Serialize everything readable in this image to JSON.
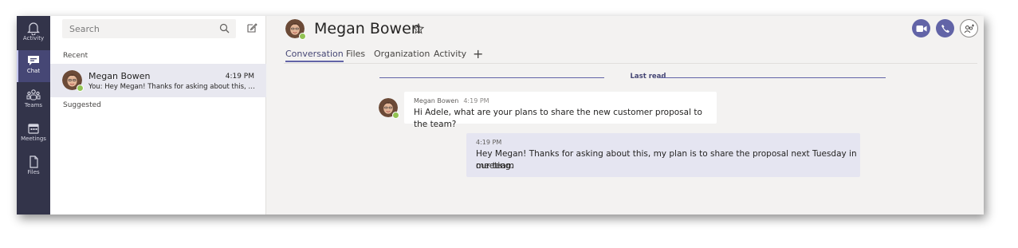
{
  "rail": {
    "items": [
      {
        "label": "Activity"
      },
      {
        "label": "Chat"
      },
      {
        "label": "Teams"
      },
      {
        "label": "Meetings"
      },
      {
        "label": "Files"
      }
    ]
  },
  "list": {
    "search_placeholder": "Search",
    "recent_label": "Recent",
    "suggested_label": "Suggested",
    "chats": [
      {
        "name": "Megan Bowen",
        "time": "4:19 PM",
        "preview": "You: Hey Megan! Thanks for asking about this, my plan is to share the proposal next Tuesday in our team meeting."
      }
    ]
  },
  "header": {
    "name": "Megan Bowen",
    "tabs": [
      {
        "label": "Conversation"
      },
      {
        "label": "Files"
      },
      {
        "label": "Organization"
      },
      {
        "label": "Activity"
      }
    ],
    "add_tab": "+"
  },
  "conversation": {
    "last_read": "Last read",
    "messages": [
      {
        "sender": "Megan Bowen",
        "time": "4:19 PM",
        "text": "Hi Adele, what are your plans to share the new customer proposal to the team?"
      },
      {
        "time": "4:19 PM",
        "line1": "Hey Megan! Thanks for asking about this, my plan is to share the proposal next Tuesday in our team",
        "line2": "meeting."
      }
    ]
  },
  "colors": {
    "rail_bg": "#33344a",
    "accent": "#6264a7",
    "presence_available": "#92c353",
    "self_bubble": "#e5e5f1"
  },
  "icons": [
    "bell-icon",
    "chat-icon",
    "teams-icon",
    "calendar-icon",
    "file-icon",
    "search-icon",
    "compose-icon",
    "star-icon",
    "video-call-icon",
    "audio-call-icon",
    "add-people-icon"
  ]
}
